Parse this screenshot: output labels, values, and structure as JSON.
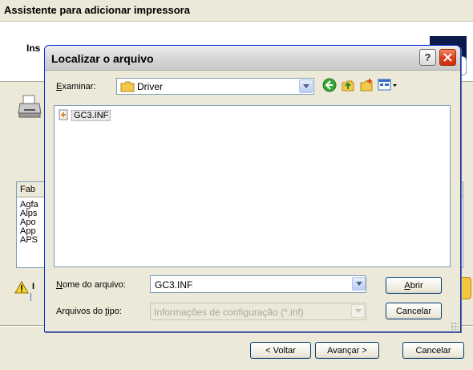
{
  "wizard": {
    "title": "Assistente para adicionar impressora",
    "heading": "Ins",
    "list_header": "Fab",
    "list_items": [
      "Agfa",
      "Alps",
      "Apo",
      "App",
      "APS"
    ],
    "warning_text": "I",
    "buttons": {
      "back": "< Voltar",
      "next": "Avançar >",
      "cancel": "Cancelar"
    }
  },
  "dialog": {
    "title": "Localizar o arquivo",
    "help_label": "?",
    "close_label": "✕",
    "lookin_label": "Examinar:",
    "lookin_value": "Driver",
    "files": [
      {
        "name": "GC3.INF",
        "icon": "inf-file-icon"
      }
    ],
    "filename_label": "Nome do arquivo:",
    "filename_value": "GC3.INF",
    "filetype_label": "Arquivos do tipo:",
    "filetype_value": "Informações de configuração (*.inf)",
    "open_label": "Abrir",
    "cancel_label": "Cancelar"
  },
  "colors": {
    "folder": "#f3c94b",
    "back_arrow": "#36a836",
    "accent_border": "#0831d9",
    "close_red": "#e0401e"
  }
}
